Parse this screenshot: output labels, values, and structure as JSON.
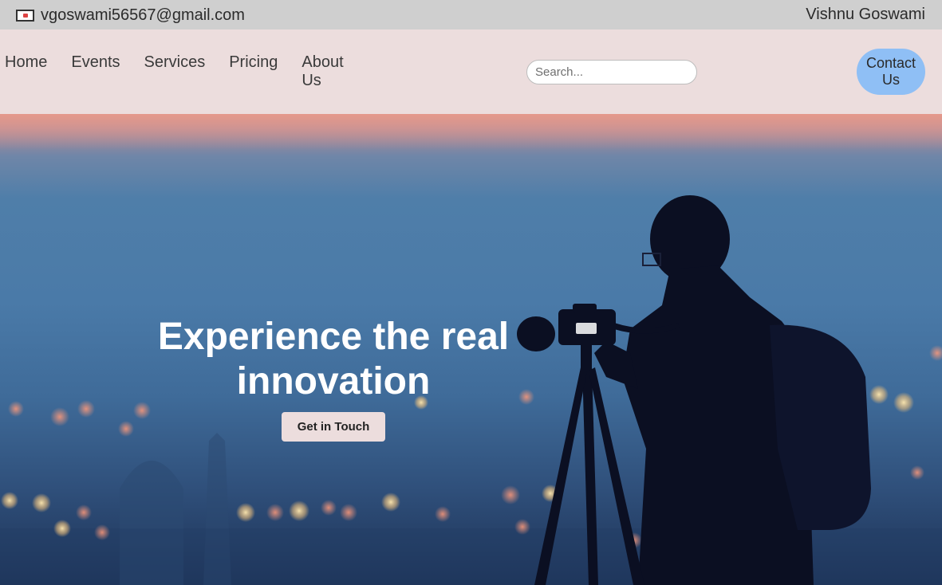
{
  "topbar": {
    "email": "vgoswami56567@gmail.com",
    "owner": "Vishnu Goswami",
    "icon": "mail-icon"
  },
  "nav": {
    "items": [
      {
        "label": "Home"
      },
      {
        "label": "Events"
      },
      {
        "label": "Services"
      },
      {
        "label": "Pricing"
      },
      {
        "label": "About Us"
      }
    ],
    "search_placeholder": "Search...",
    "contact_label": "Contact Us"
  },
  "hero": {
    "title": "Experience the real innovation",
    "cta_label": "Get in Touch",
    "image": "photographer with camera on tripod at dusk over city bokeh lights"
  },
  "colors": {
    "topbar_bg": "#cfcfcf",
    "navbar_bg": "#ecdddd",
    "contact_bg": "#8fbff5",
    "cta_bg": "#ecdddd"
  }
}
